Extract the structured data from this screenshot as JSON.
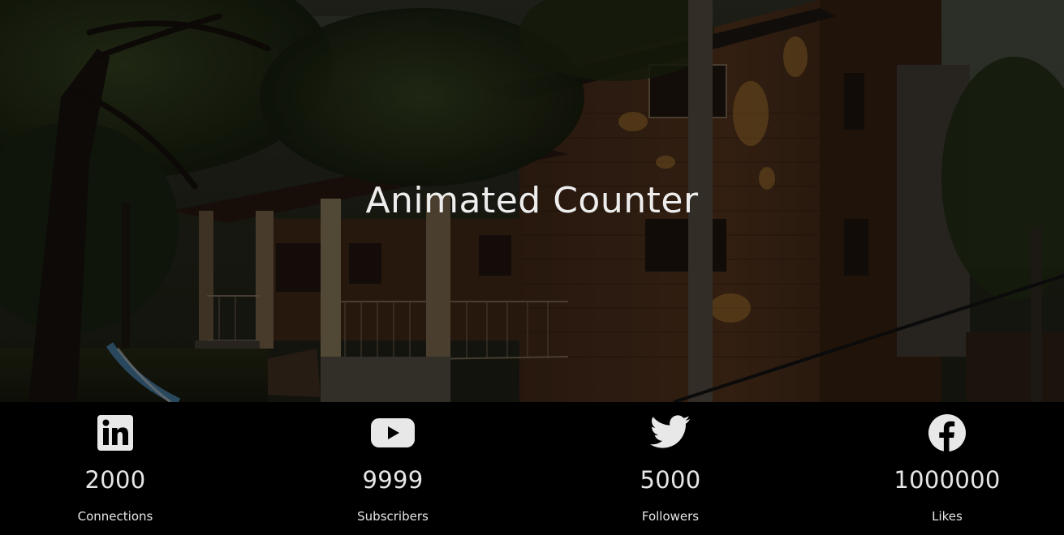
{
  "hero": {
    "title": "Animated Counter"
  },
  "counters": [
    {
      "icon": "linkedin-icon",
      "value": "2000",
      "label": "Connections"
    },
    {
      "icon": "youtube-icon",
      "value": "9999",
      "label": "Subscribers"
    },
    {
      "icon": "twitter-icon",
      "value": "5000",
      "label": "Followers"
    },
    {
      "icon": "facebook-icon",
      "value": "1000000",
      "label": "Likes"
    }
  ],
  "colors": {
    "section_background": "#000000",
    "text": "#e6e6e6",
    "icon": "#e8e8e8"
  }
}
